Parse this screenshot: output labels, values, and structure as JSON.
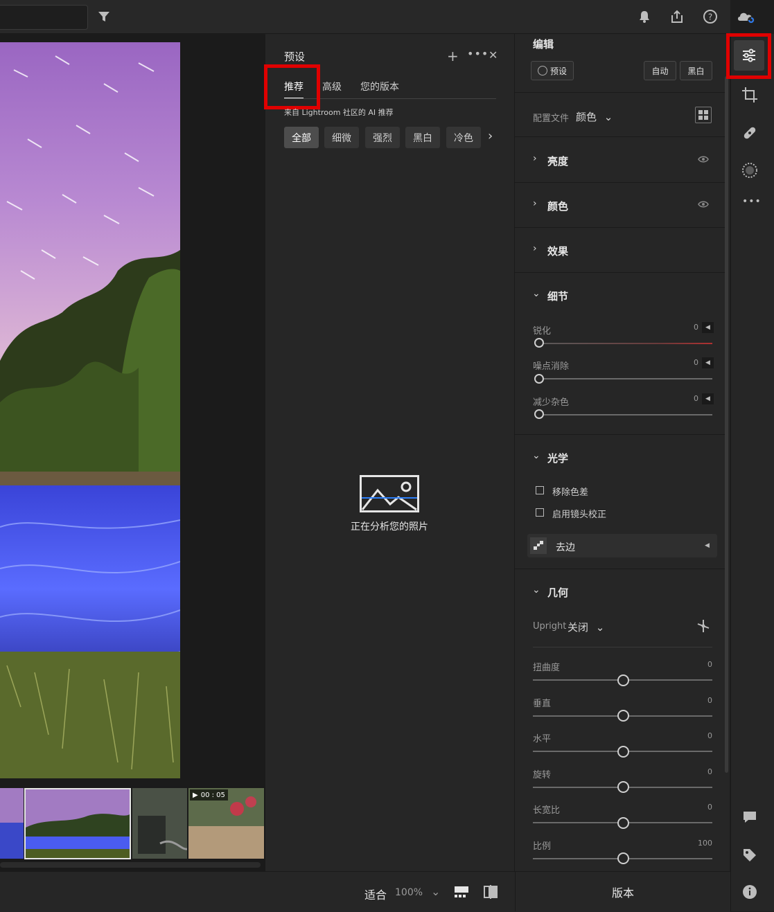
{
  "presets": {
    "title": "预设",
    "tabs": [
      "推荐",
      "高级",
      "您的版本"
    ],
    "subtitle": "来自 Lightroom 社区的 AI 推荐",
    "chips": [
      "全部",
      "细微",
      "强烈",
      "黑白",
      "冷色"
    ],
    "analyzing": "正在分析您的照片"
  },
  "edit": {
    "title": "编辑",
    "preset_btn": "预设",
    "auto_btn": "自动",
    "bw_btn": "黑白",
    "profile_label": "配置文件",
    "profile_value": "颜色",
    "sections": {
      "light": "亮度",
      "color": "颜色",
      "effects": "效果",
      "detail": "细节",
      "optics": "光学",
      "geometry": "几何"
    },
    "detail_sliders": [
      {
        "label": "锐化",
        "value": "0"
      },
      {
        "label": "噪点消除",
        "value": "0"
      },
      {
        "label": "减少杂色",
        "value": "0"
      }
    ],
    "optics": {
      "remove_ca": "移除色差",
      "lens_correction": "启用镜头校正",
      "defringe": "去边"
    },
    "geometry": {
      "upright_label": "Upright",
      "upright_value": "关闭",
      "sliders": [
        {
          "label": "扭曲度",
          "value": "0"
        },
        {
          "label": "垂直",
          "value": "0"
        },
        {
          "label": "水平",
          "value": "0"
        },
        {
          "label": "旋转",
          "value": "0"
        },
        {
          "label": "长宽比",
          "value": "0"
        },
        {
          "label": "比例",
          "value": "100"
        }
      ]
    }
  },
  "filmstrip": {
    "video_duration": "00 : 05"
  },
  "bottombar": {
    "fit_label": "适合",
    "zoom": "100%",
    "versions": "版本"
  },
  "colors": {
    "highlight": "#e00000",
    "accent": "#2d7ff9",
    "panel": "#262626"
  },
  "icons": [
    "filter-icon",
    "bell-icon",
    "share-icon",
    "help-icon",
    "cloud-sync-icon",
    "edit-sliders-icon",
    "crop-icon",
    "healing-icon",
    "masking-icon",
    "more-icon",
    "comment-icon",
    "tag-icon",
    "info-icon"
  ]
}
